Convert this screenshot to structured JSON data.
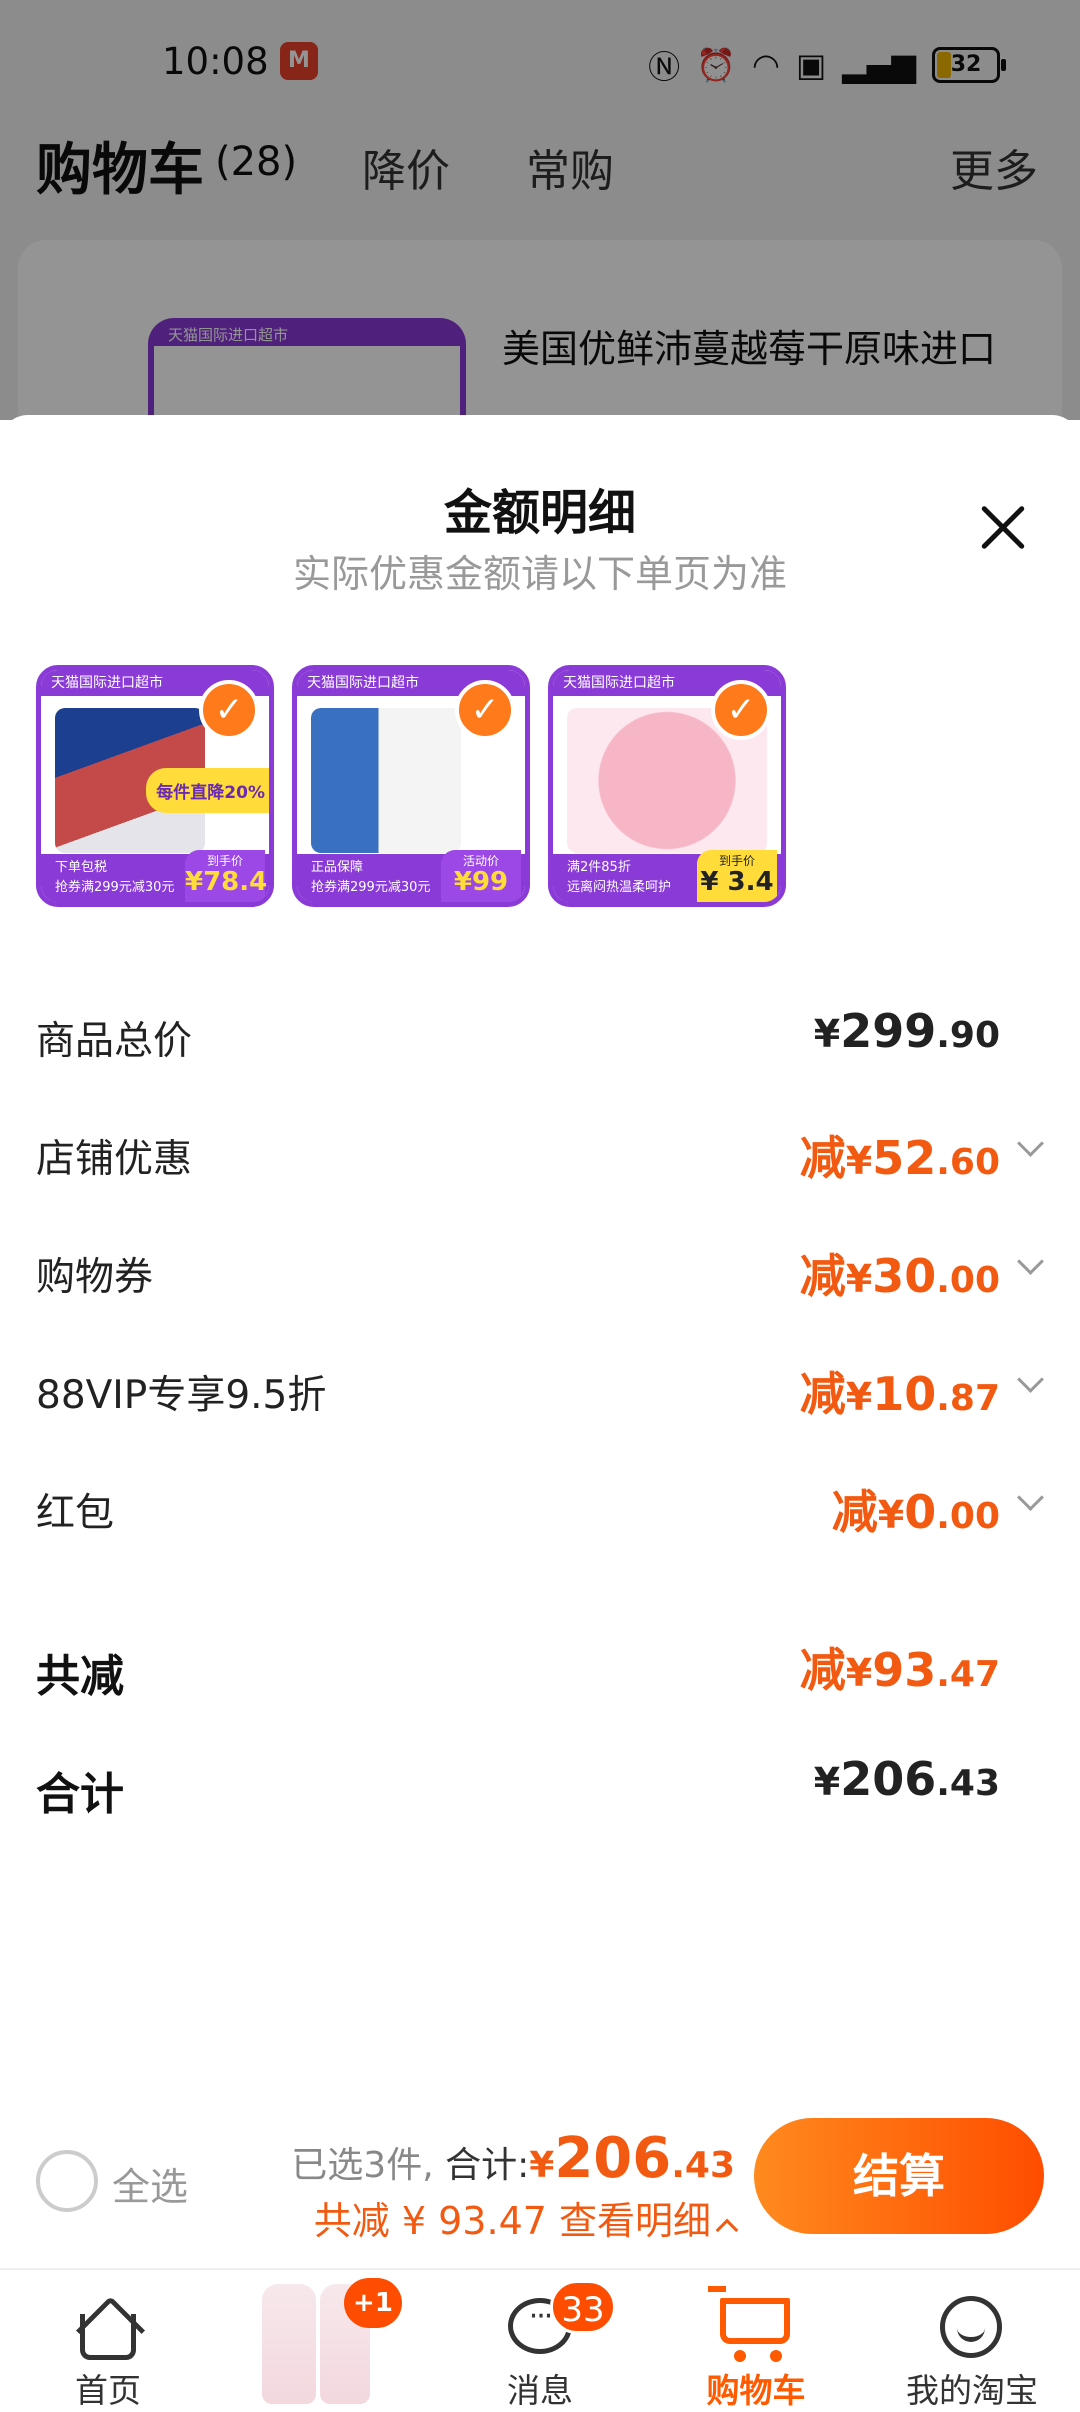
{
  "statusbar": {
    "time": "10:08",
    "app_icon_text": "M",
    "battery": "32",
    "icons": [
      "nfc-icon",
      "alarm-icon",
      "wifi-icon",
      "hd-icon",
      "5g-signal-icon",
      "battery-icon"
    ]
  },
  "background": {
    "cart_title": "购物车",
    "cart_count": "(28)",
    "tab_price_drop": "降价",
    "tab_frequent": "常购",
    "more": "更多",
    "product_title": "美国优鲜沛蔓越莓干原味进口",
    "thumb_header": "天猫国际进口超市"
  },
  "sheet": {
    "title": "金额明细",
    "subtitle": "实际优惠金额请以下单页为准",
    "products": [
      {
        "header": "天猫国际进口超市",
        "badge": "每件直降20%",
        "tag_line1": "下单包税",
        "tag_line2": "抢券满299元减30元",
        "price_label": "到手价",
        "price": "¥78.4",
        "checked": true
      },
      {
        "header": "天猫国际进口超市",
        "badge": "",
        "tag_line1": "正品保障",
        "tag_line2": "抢券满299元减30元",
        "price_label": "活动价",
        "price": "¥99",
        "checked": true
      },
      {
        "header": "天猫国际进口超市",
        "badge": "",
        "tag_line1": "满2件85折",
        "tag_line2": "远离闷热温柔呵护",
        "price_label": "到手价",
        "price": "¥ 3.4",
        "checked": true
      }
    ],
    "rows": [
      {
        "label": "商品总价",
        "prefix": "",
        "currency": "¥",
        "int": "299",
        "dec": ".90",
        "orange": false,
        "chevron": false
      },
      {
        "label": "店铺优惠",
        "prefix": "减",
        "currency": "¥",
        "int": "52",
        "dec": ".60",
        "orange": true,
        "chevron": true
      },
      {
        "label": "购物券",
        "prefix": "减",
        "currency": "¥",
        "int": "30",
        "dec": ".00",
        "orange": true,
        "chevron": true
      },
      {
        "label": "88VIP专享9.5折",
        "prefix": "减",
        "currency": "¥",
        "int": "10",
        "dec": ".87",
        "orange": true,
        "chevron": true
      },
      {
        "label": "红包",
        "prefix": "减",
        "currency": "¥",
        "int": "0",
        "dec": ".00",
        "orange": true,
        "chevron": true
      }
    ],
    "total_reduce": {
      "label": "共减",
      "prefix": "减",
      "currency": "¥",
      "int": "93",
      "dec": ".47"
    },
    "total": {
      "label": "合计",
      "currency": "¥",
      "int": "206",
      "dec": ".43"
    }
  },
  "checkout": {
    "select_all": "全选",
    "selected_text": "已选3件,",
    "total_label": "合计:",
    "total_currency": "¥",
    "total_int": "206",
    "total_dec": ".43",
    "reduce_text": "共减 ¥ 93.47 查看明细",
    "pay_button": "结算"
  },
  "tabbar": {
    "home": "首页",
    "promo_badge": "+1",
    "messages": "消息",
    "messages_count": "33",
    "cart": "购物车",
    "mine": "我的淘宝"
  },
  "colors": {
    "accent": "#ff5a00",
    "discount": "#f25a12",
    "promo_purple": "#8a3ad6",
    "promo_yellow": "#ffdc3a"
  }
}
